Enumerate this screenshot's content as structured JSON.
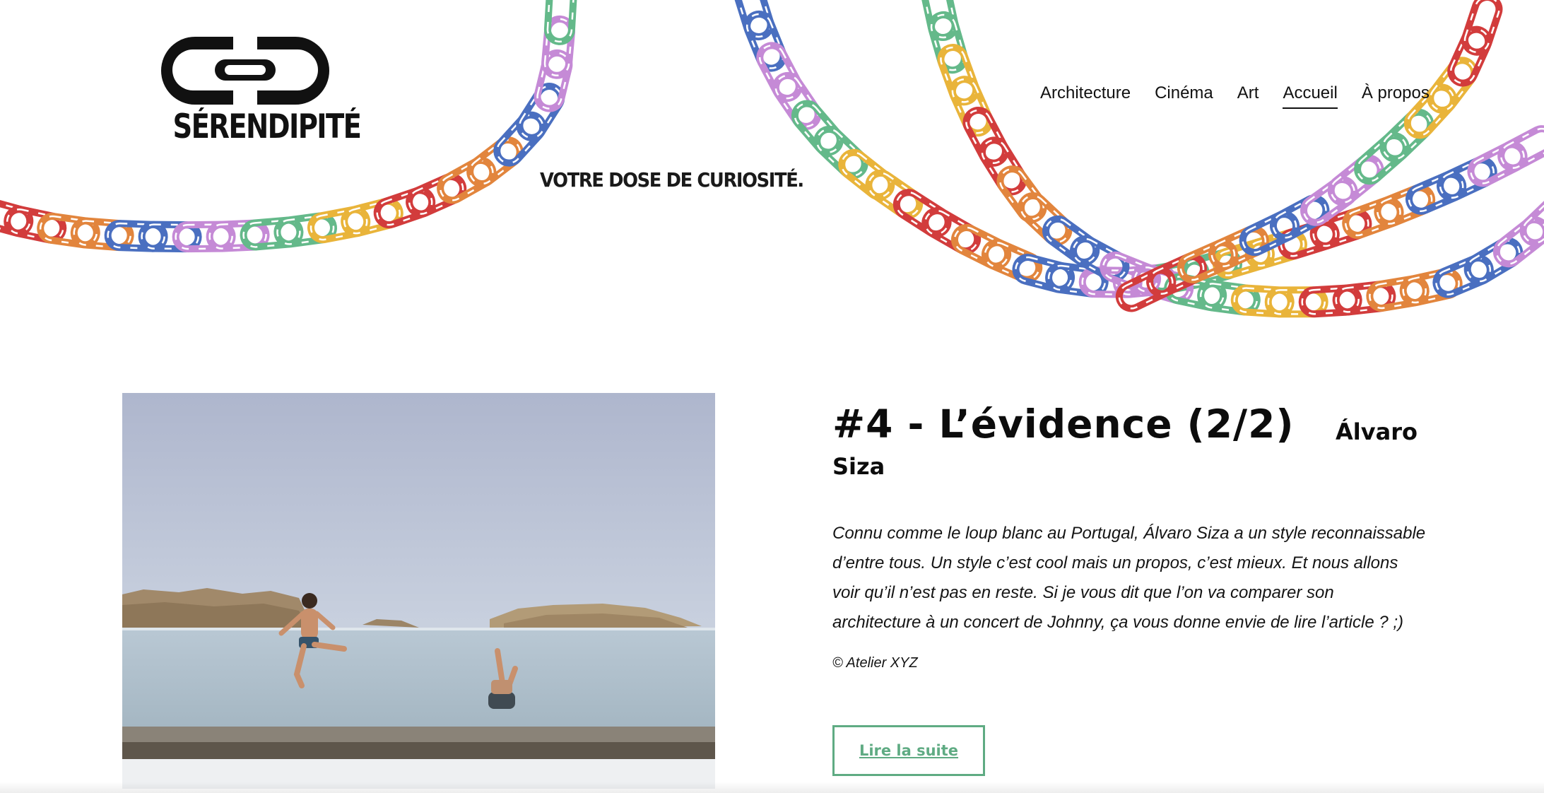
{
  "brand": {
    "name": "SÉRENDIPITÉ",
    "tagline": "VOTRE DOSE DE CURIOSITÉ."
  },
  "nav": {
    "items": [
      {
        "label": "Architecture",
        "active": false
      },
      {
        "label": "Cinéma",
        "active": false
      },
      {
        "label": "Art",
        "active": false
      },
      {
        "label": "Accueil",
        "active": true
      },
      {
        "label": "À propos",
        "active": false
      }
    ]
  },
  "article": {
    "title": "#4 - L’évidence (2/2)",
    "subtitle_part1": "Álvaro",
    "subtitle_part2": "Siza",
    "excerpt": "Connu comme le loup blanc au Portugal, Álvaro Siza a un style reconnaissable d’entre tous. Un style c’est cool mais un propos, c’est mieux. Et nous allons voir qu’il n’est pas en reste. Si je vous dit que l’on va comparer son architecture à un concert de Johnny, ça vous donne envie de lire l’article ? ;)",
    "credit": "© Atelier XYZ",
    "read_more": "Lire la suite"
  },
  "colors": {
    "accent_green": "#5fab83",
    "chain": [
      "#d23c3c",
      "#e2853d",
      "#4a6fc0",
      "#c58ad6",
      "#64b98a",
      "#e9b43a"
    ]
  },
  "icons": {
    "logo": "chain-link-logo-icon",
    "chains": "colorful-chain-decoration"
  }
}
